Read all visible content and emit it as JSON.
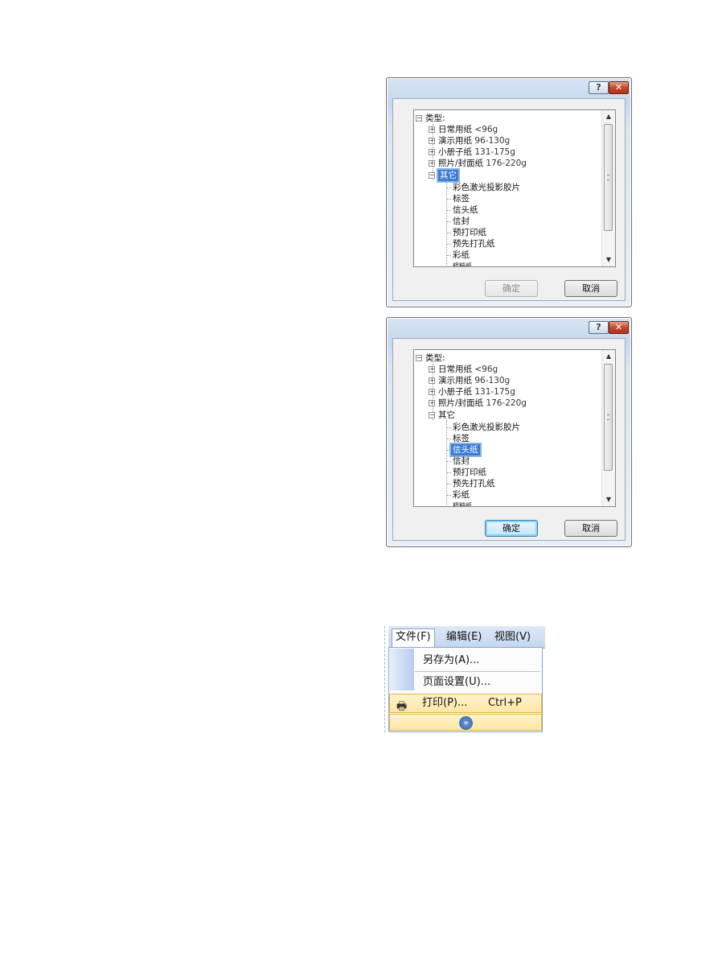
{
  "dialog1": {
    "help_label": "?",
    "close_label": "✕",
    "tree": {
      "root": "类型:",
      "paper_types": [
        {
          "name": "日常用纸",
          "weight": "<96g"
        },
        {
          "name": "演示用纸",
          "weight": "96-130g"
        },
        {
          "name": "小册子纸",
          "weight": "131-175g"
        },
        {
          "name": "照片/封面纸",
          "weight": "176-220g"
        }
      ],
      "other": "其它",
      "other_items": [
        "彩色激光投影胶片",
        "标签",
        "信头纸",
        "信封",
        "预打印纸",
        "预先打孔纸",
        "彩纸",
        "粗糙纸"
      ]
    },
    "ok_label": "确定",
    "cancel_label": "取消"
  },
  "dialog2": {
    "help_label": "?",
    "close_label": "✕",
    "tree": {
      "root": "类型:",
      "paper_types": [
        {
          "name": "日常用纸",
          "weight": "<96g"
        },
        {
          "name": "演示用纸",
          "weight": "96-130g"
        },
        {
          "name": "小册子纸",
          "weight": "131-175g"
        },
        {
          "name": "照片/封面纸",
          "weight": "176-220g"
        }
      ],
      "other": "其它",
      "other_items": [
        "彩色激光投影胶片",
        "标签",
        "信头纸",
        "信封",
        "预打印纸",
        "预先打孔纸",
        "彩纸",
        "粗糙纸"
      ]
    },
    "ok_label": "确定",
    "cancel_label": "取消"
  },
  "menu": {
    "bar": [
      "文件(F)",
      "编辑(E)",
      "视图(V)"
    ],
    "items": {
      "save_as": "另存为(A)...",
      "page_setup": "页面设置(U)...",
      "print": "打印(P)...",
      "print_shortcut": "Ctrl+P",
      "expand": "»"
    }
  }
}
